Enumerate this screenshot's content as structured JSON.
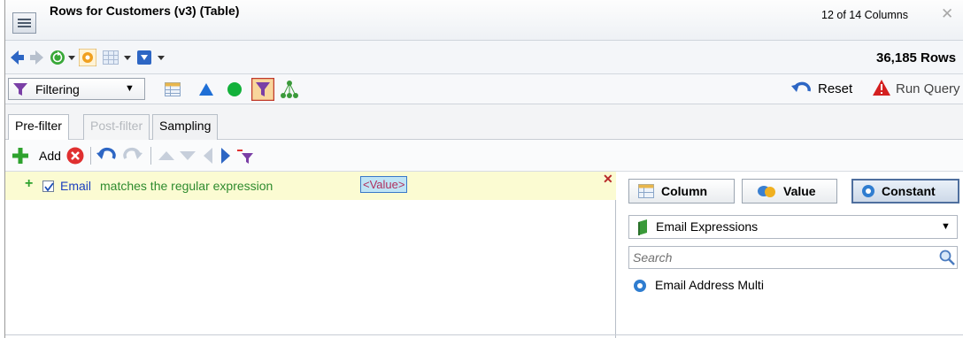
{
  "window": {
    "title": "Rows for Customers (v3) (Table)",
    "column_count": "12 of 14 Columns",
    "close_glyph": "✕"
  },
  "nav": {
    "row_count": "36,185 Rows"
  },
  "filterbar": {
    "mode_selected": "Filtering",
    "reset_label": "Reset",
    "run_query_label": "Run Query"
  },
  "tabs": [
    {
      "label": "Pre-filter",
      "state": "active"
    },
    {
      "label": "Post-filter",
      "state": "disabled"
    },
    {
      "label": "Sampling",
      "state": "normal"
    }
  ],
  "actions": {
    "add_label": "Add"
  },
  "condition": {
    "field": "Email",
    "operator": "matches the regular expression",
    "value": "<Value>",
    "checked": true
  },
  "value_panel": {
    "segments": [
      {
        "label": "Column"
      },
      {
        "label": "Value"
      },
      {
        "label": "Constant"
      }
    ],
    "selected_segment": "Constant",
    "dropdown_selected": "Email Expressions",
    "search_placeholder": "Search",
    "items": [
      {
        "label": "Email Address Multi",
        "icon": "gear-icon"
      }
    ]
  },
  "colors": {
    "condition_highlight": "#fbfbd2",
    "field_color": "#1b3fbf",
    "operator_color": "#2e8b2e",
    "warning_red": "#d42020"
  }
}
